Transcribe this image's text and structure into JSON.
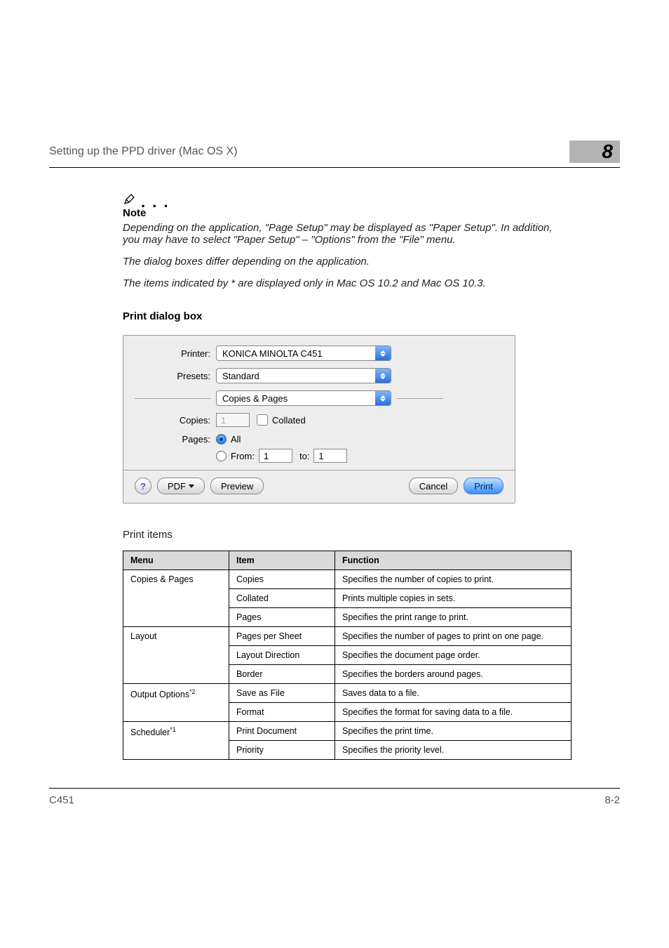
{
  "header": {
    "title": "Setting up the PPD driver (Mac OS X)",
    "chapter": "8"
  },
  "note": {
    "label": "Note",
    "paragraphs": [
      "Depending on the application, \"Page Setup\" may be displayed as \"Paper Setup\". In addition, you may have to select \"Paper Setup\" – \"Options\" from the \"File\" menu.",
      "The dialog boxes differ depending on the application.",
      "The items indicated by * are displayed only in Mac OS 10.2 and Mac OS 10.3."
    ]
  },
  "section_heading": "Print dialog box",
  "dialog": {
    "printer_label": "Printer:",
    "printer_value": "KONICA MINOLTA C451",
    "presets_label": "Presets:",
    "presets_value": "Standard",
    "pane_value": "Copies & Pages",
    "copies_label": "Copies:",
    "copies_value": "1",
    "collated_label": "Collated",
    "pages_label": "Pages:",
    "pages_all_label": "All",
    "pages_from_label": "From:",
    "pages_from_value": "1",
    "pages_to_label": "to:",
    "pages_to_value": "1",
    "help": "?",
    "pdf_btn": "PDF",
    "preview_btn": "Preview",
    "cancel_btn": "Cancel",
    "print_btn": "Print"
  },
  "print_items_heading": "Print items",
  "table": {
    "headers": {
      "menu": "Menu",
      "item": "Item",
      "function": "Function"
    },
    "groups": [
      {
        "menu": "Copies & Pages",
        "rows": [
          {
            "item": "Copies",
            "function": "Specifies the number of copies to print."
          },
          {
            "item": "Collated",
            "function": "Prints multiple copies in sets."
          },
          {
            "item": "Pages",
            "function": "Specifies the print range to print."
          }
        ]
      },
      {
        "menu": "Layout",
        "rows": [
          {
            "item": "Pages per Sheet",
            "function": "Specifies the number of pages to print on one page."
          },
          {
            "item": "Layout Direction",
            "function": "Specifies the document page order."
          },
          {
            "item": "Border",
            "function": "Specifies the borders around pages."
          }
        ]
      },
      {
        "menu": "Output Options",
        "menu_sup": "*2",
        "rows": [
          {
            "item": "Save as File",
            "function": "Saves data to a file."
          },
          {
            "item": "Format",
            "function": "Specifies the format for saving data to a file."
          }
        ]
      },
      {
        "menu": "Scheduler",
        "menu_sup": "*1",
        "rows": [
          {
            "item": "Print Document",
            "function": "Specifies the print time."
          },
          {
            "item": "Priority",
            "function": "Specifies the priority level."
          }
        ]
      }
    ]
  },
  "footer": {
    "left": "C451",
    "right": "8-2"
  }
}
